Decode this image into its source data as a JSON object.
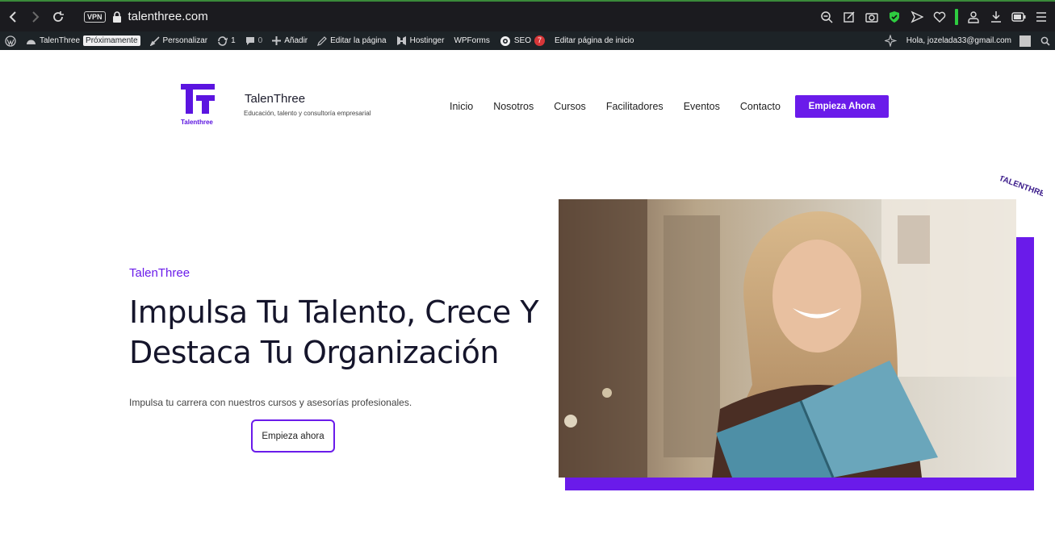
{
  "browser": {
    "vpn_label": "VPN",
    "url": "talenthree.com"
  },
  "wp_admin": {
    "site": "TalenThree",
    "status_badge": "Próximamente",
    "customize": "Personalizar",
    "updates_count": "1",
    "comments_count": "0",
    "add_new": "Añadir",
    "edit_page": "Editar la página",
    "hostinger": "Hostinger",
    "wpforms": "WPForms",
    "seo": "SEO",
    "seo_count": "7",
    "edit_home": "Editar página de inicio",
    "greeting": "Hola, jozelada33@gmail.com"
  },
  "header": {
    "logo_text": "Talenthree",
    "site_name": "TalenThree",
    "tagline": "Educación, talento y consultoría empresarial",
    "nav": [
      "Inicio",
      "Nosotros",
      "Cursos",
      "Facilitadores",
      "Eventos",
      "Contacto"
    ],
    "cta": "Empieza Ahora"
  },
  "hero": {
    "kicker": "TalenThree",
    "title_line1": "Impulsa Tu Talento, Crece Y",
    "title_line2": "Destaca Tu Organización",
    "subtitle": "Impulsa tu carrera con nuestros cursos y asesorías profesionales.",
    "button": "Empieza ahora",
    "badge_text": "TALENTHREE"
  },
  "colors": {
    "brand": "#6a1bea",
    "admin_bar": "#1d2327",
    "browser_bar": "#1b1b1f"
  }
}
